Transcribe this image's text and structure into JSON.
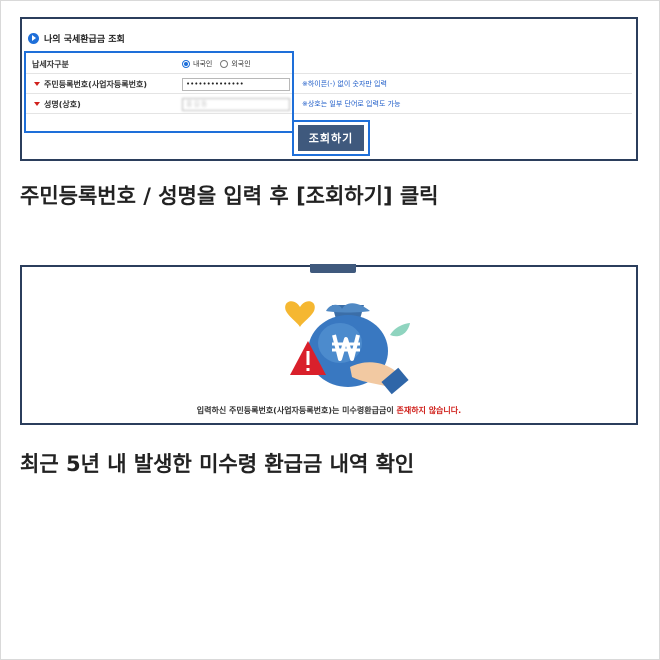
{
  "form_panel": {
    "section_title": "나의 국세환급금 조회",
    "rows": [
      {
        "label": "납세자구분",
        "options": [
          "내국인",
          "외국인"
        ],
        "selected": "내국인"
      },
      {
        "label": "주민등록번호(사업자등록번호)",
        "value": "••••••••••••••",
        "hint": "※하이픈(-) 없이 숫자만 입력"
      },
      {
        "label": "성명(상호)",
        "value": "홍길동",
        "hint": "※상호는 일부 단어로 입력도 가능"
      }
    ],
    "search_button": "조회하기"
  },
  "caption1": "주민등록번호 / 성명을 입력 후 [조회하기] 클릭",
  "result_panel": {
    "message_prefix": "입력하신 주민등록번호(사업자등록번호)는 미수령환급금이 ",
    "message_highlight": "존재하지 않습니다.",
    "illustration": {
      "icons": [
        "heart-icon",
        "money-bag-icon",
        "won-icon",
        "warning-icon",
        "hand-icon",
        "leaf-icon"
      ]
    }
  },
  "caption2": "최근 5년 내 발생한 미수령 환급금 내역 확인",
  "colors": {
    "panel_border": "#2b3e5c",
    "highlight": "#1e6fd9",
    "button": "#3f597d",
    "hint_text": "#1e5cc8",
    "alert_red": "#d0211c"
  }
}
